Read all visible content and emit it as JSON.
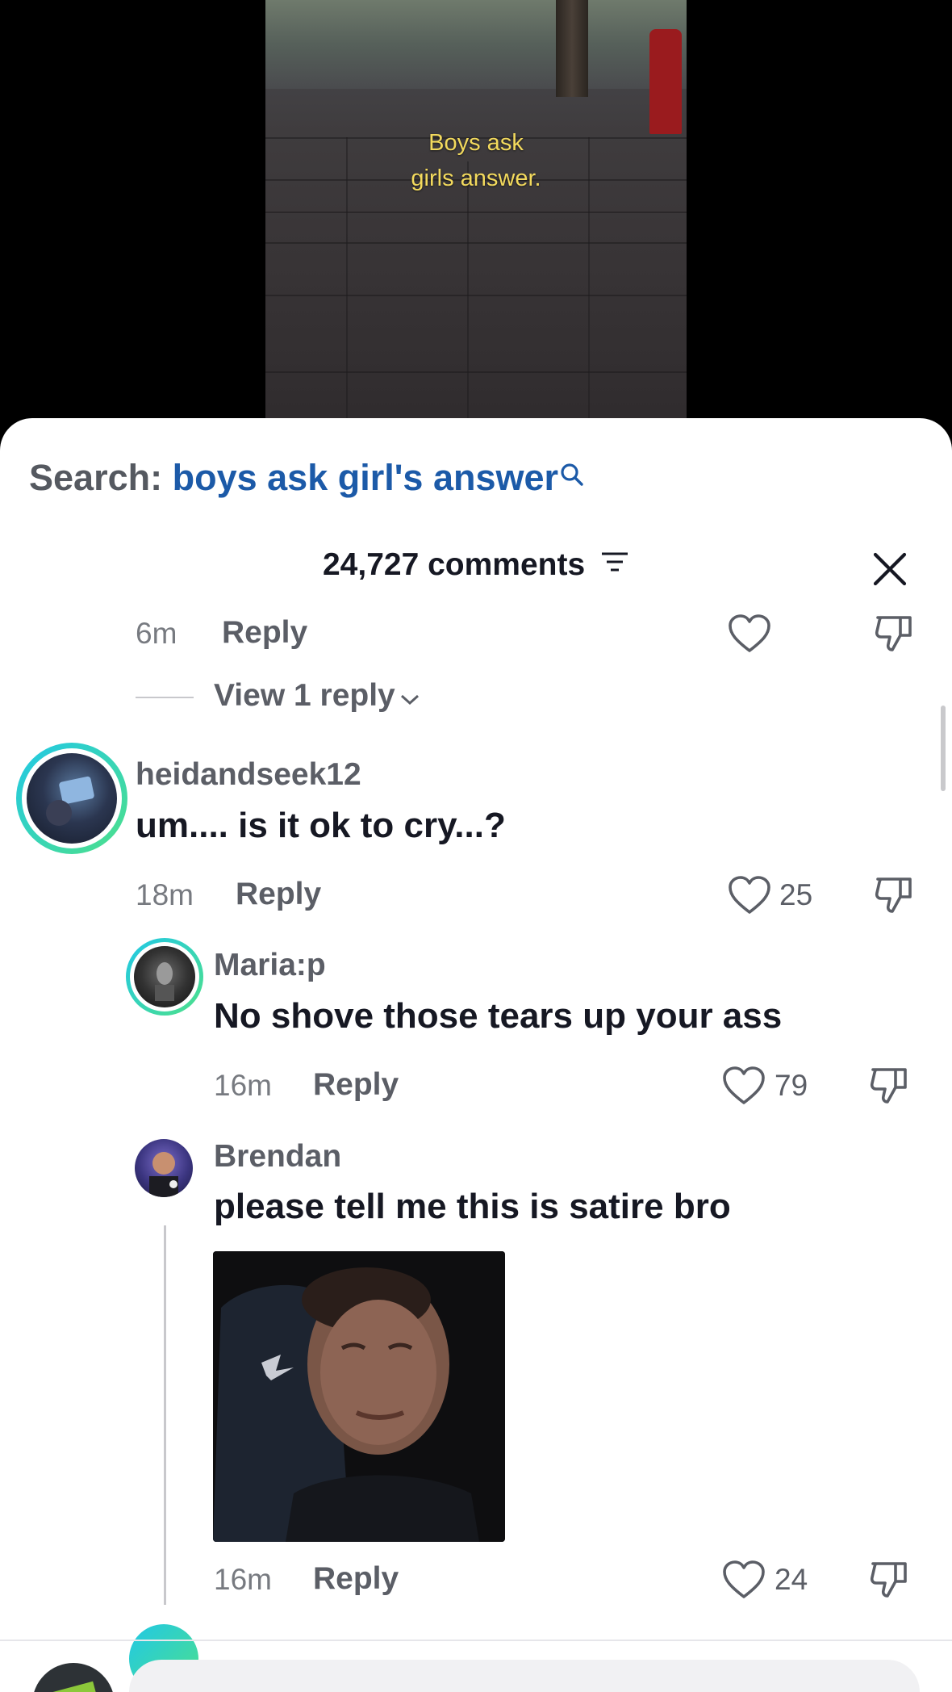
{
  "video": {
    "caption_line1": "Boys ask",
    "caption_line2": "girls answer."
  },
  "search": {
    "label": "Search:",
    "query": "boys ask girl's answer"
  },
  "comments_header": {
    "count_label": "24,727 comments"
  },
  "prev_comment": {
    "time": "6m",
    "reply_label": "Reply",
    "view_replies_label": "View 1 reply"
  },
  "comments": [
    {
      "username": "heidandseek12",
      "text": "um.... is it ok to cry...?",
      "time": "18m",
      "reply_label": "Reply",
      "likes": "25"
    },
    {
      "username": "Maria:p",
      "text": "No shove those tears up your ass",
      "time": "16m",
      "reply_label": "Reply",
      "likes": "79"
    },
    {
      "username": "Brendan",
      "text": "please tell me this is satire bro",
      "time": "16m",
      "reply_label": "Reply",
      "likes": "24"
    }
  ],
  "colors": {
    "search_query": "#1c5aa8",
    "ring_gradient_start": "#21c8e6",
    "ring_gradient_end": "#4de08a",
    "caption": "#f3da5d"
  }
}
